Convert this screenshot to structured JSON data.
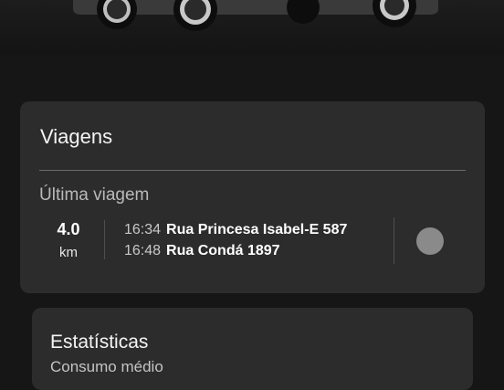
{
  "trips": {
    "title": "Viagens",
    "last_trip_label": "Última viagem",
    "distance_value": "4.0",
    "distance_unit": "km",
    "start_time": "16:34",
    "start_address": "Rua Princesa Isabel-E 587",
    "end_time": "16:48",
    "end_address": "Rua Condá 1897"
  },
  "stats": {
    "title": "Estatísticas",
    "subtitle": "Consumo médio"
  },
  "colors": {
    "background": "#161616",
    "card": "#2c2c2c",
    "status_dot": "#8a8a8a"
  }
}
